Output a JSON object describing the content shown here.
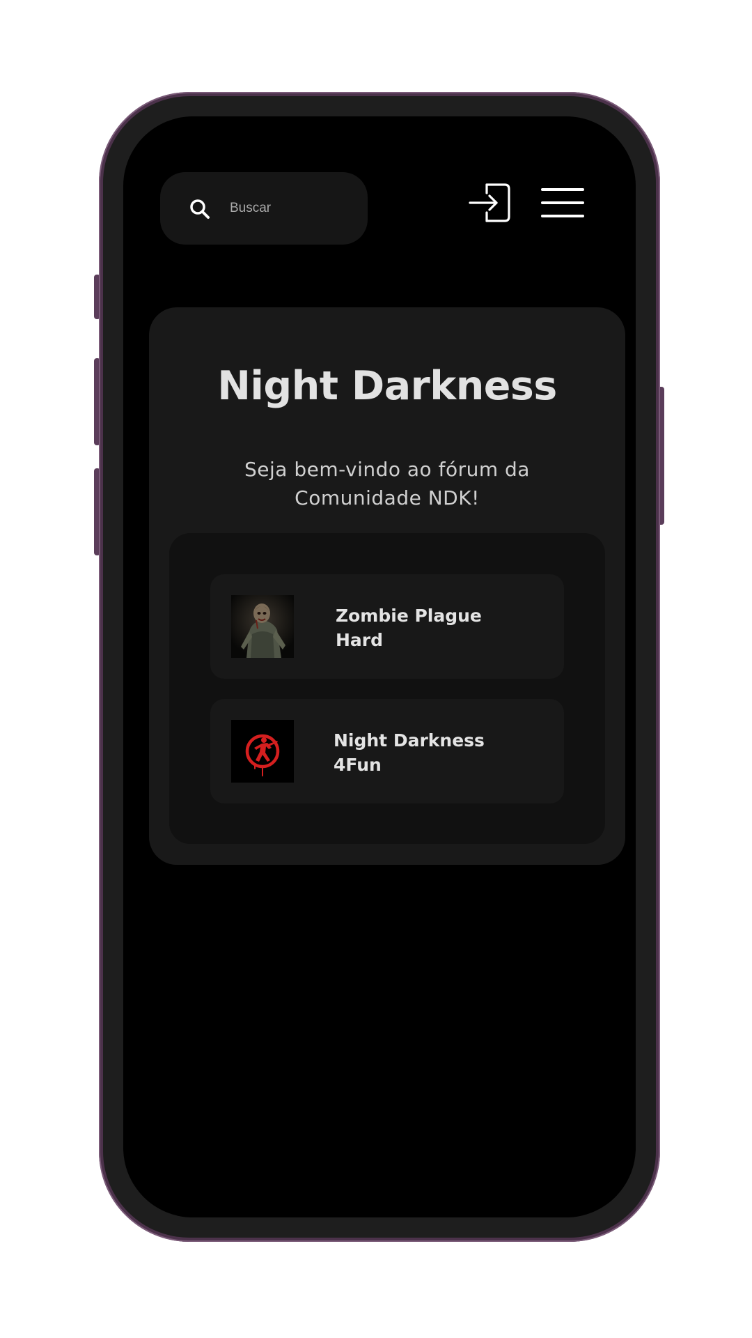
{
  "header": {
    "search_placeholder": "Buscar"
  },
  "hero": {
    "title": "Night Darkness",
    "subtitle": "Seja bem-vindo ao fórum da Comunidade NDK!"
  },
  "servers": [
    {
      "name_line1": "Zombie Plague",
      "name_line2": "Hard",
      "thumbnail": "zombie-thumbnail"
    },
    {
      "name_line1": "Night Darkness",
      "name_line2": "4Fun",
      "thumbnail": "counter-strike-logo"
    }
  ],
  "colors": {
    "background": "#000000",
    "card": "#191919",
    "panel": "#111111",
    "item": "#181818",
    "text": "#e2e2e2",
    "logo_red": "#d51f1f",
    "phone_frame": "#4c324b"
  },
  "icons": {
    "search": "search-icon",
    "login": "login-icon",
    "menu": "hamburger-menu-icon"
  }
}
